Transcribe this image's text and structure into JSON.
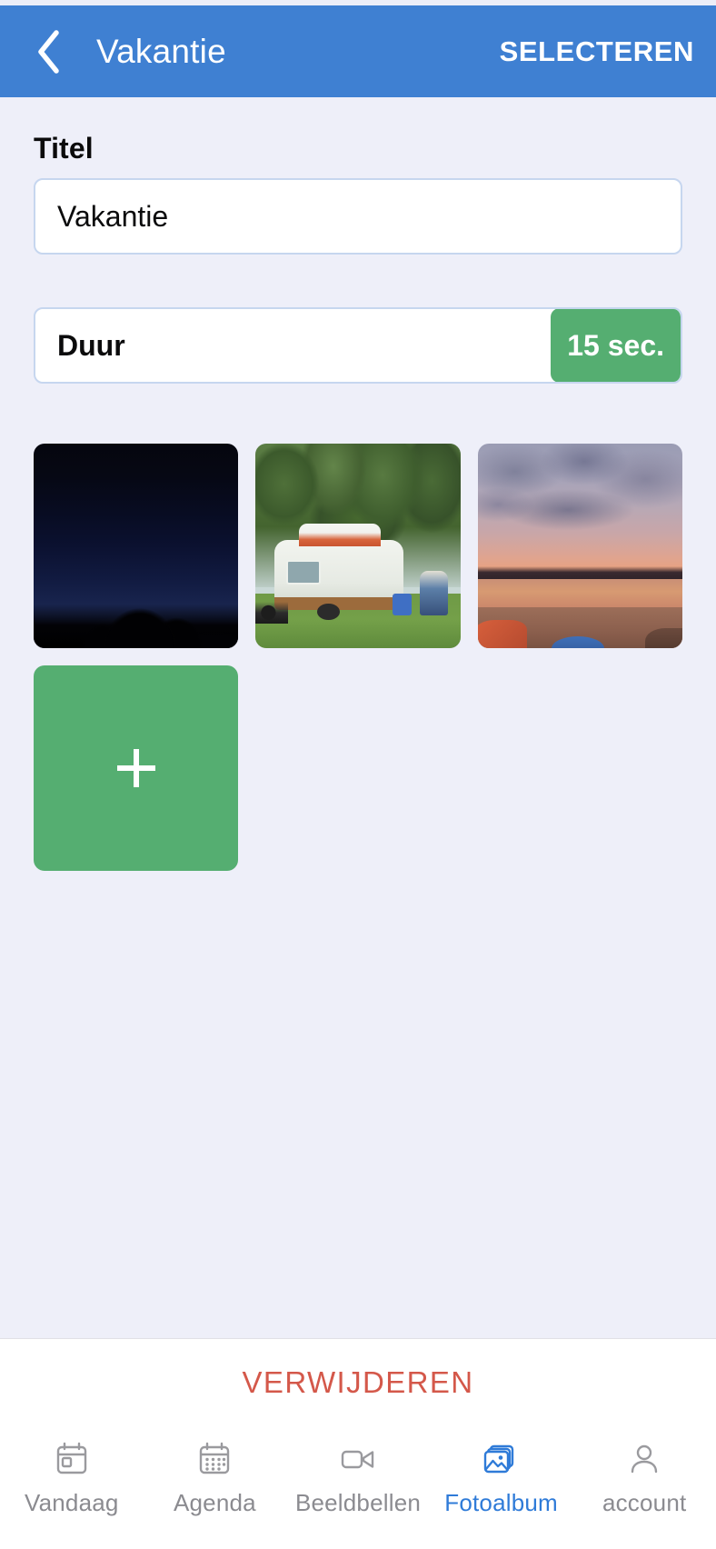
{
  "header": {
    "back_icon": "chevron-left-icon",
    "title": "Vakantie",
    "action_label": "SELECTEREN",
    "background": "#3f80d2"
  },
  "form": {
    "title_label": "Titel",
    "title_value": "Vakantie",
    "title_placeholder": "Titel",
    "duration_label": "Duur",
    "duration_value": "15 sec.",
    "duration_badge_color": "#55ae71"
  },
  "photos": [
    {
      "name": "night-sky-photo",
      "description": "Nachtelijke hemel met boomsilhouet"
    },
    {
      "name": "caravan-photo",
      "description": "Witte caravan op grasveld met bomen"
    },
    {
      "name": "beach-sunset-photo",
      "description": "Zonsondergang aan het strand"
    }
  ],
  "add_tile": {
    "icon": "plus-icon",
    "color": "#55ae71"
  },
  "delete": {
    "label": "VERWIJDEREN",
    "color": "#d4584a"
  },
  "tabbar": {
    "active_color": "#2f7bd8",
    "inactive_color": "#8b8b90",
    "items": [
      {
        "label": "Vandaag",
        "icon": "today-calendar-icon",
        "active": false
      },
      {
        "label": "Agenda",
        "icon": "calendar-icon",
        "active": false
      },
      {
        "label": "Beeldbellen",
        "icon": "video-camera-icon",
        "active": false
      },
      {
        "label": "Fotoalbum",
        "icon": "photo-album-icon",
        "active": true
      },
      {
        "label": "account",
        "icon": "person-icon",
        "active": false
      }
    ]
  }
}
